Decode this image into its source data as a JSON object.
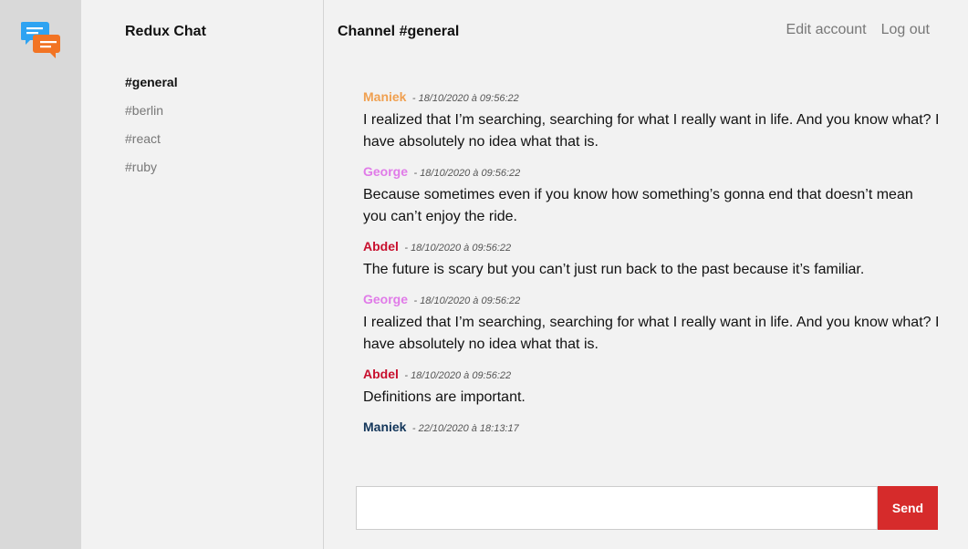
{
  "app": {
    "title": "Redux Chat",
    "logo_icon": "chat-bubbles-icon"
  },
  "channels": [
    {
      "label": "#general",
      "active": true
    },
    {
      "label": "#berlin",
      "active": false
    },
    {
      "label": "#react",
      "active": false
    },
    {
      "label": "#ruby",
      "active": false
    }
  ],
  "header": {
    "title": "Channel #general",
    "edit_account": "Edit account",
    "log_out": "Log out"
  },
  "messages": [
    {
      "author": "Maniek",
      "color": "#f0a050",
      "date": "- 18/10/2020 à 09:56:22",
      "text": "I realized that I’m searching, searching for what I really want in life. And you know what? I have absolutely no idea what that is."
    },
    {
      "author": "George",
      "color": "#e07be8",
      "date": "- 18/10/2020 à 09:56:22",
      "text": "Because sometimes even if you know how something’s gonna end that doesn’t mean you can’t enjoy the ride."
    },
    {
      "author": "Abdel",
      "color": "#c8102e",
      "date": "- 18/10/2020 à 09:56:22",
      "text": "The future is scary but you can’t just run back to the past because it’s familiar."
    },
    {
      "author": "George",
      "color": "#e07be8",
      "date": "- 18/10/2020 à 09:56:22",
      "text": "I realized that I’m searching, searching for what I really want in life. And you know what? I have absolutely no idea what that is."
    },
    {
      "author": "Abdel",
      "color": "#c8102e",
      "date": "- 18/10/2020 à 09:56:22",
      "text": "Definitions are important."
    },
    {
      "author": "Maniek",
      "color": "#13365a",
      "date": "- 22/10/2020 à 18:13:17",
      "text": ""
    }
  ],
  "composer": {
    "value": "",
    "placeholder": "",
    "send_label": "Send",
    "send_color": "#d62b2b"
  }
}
